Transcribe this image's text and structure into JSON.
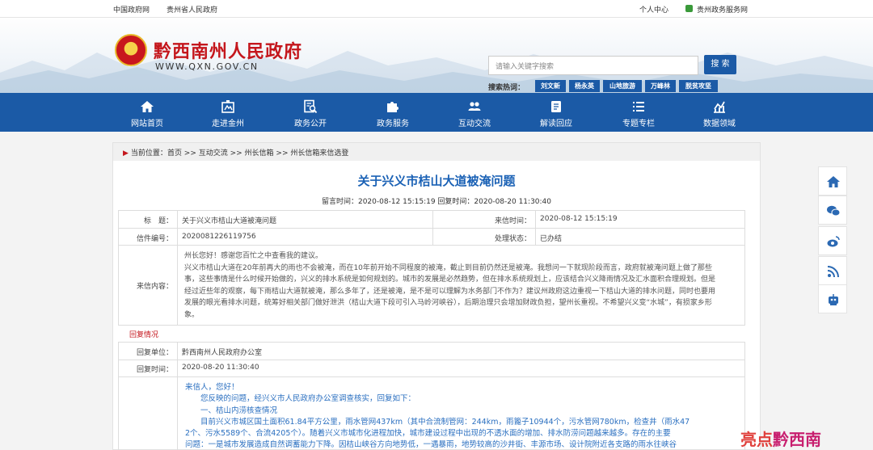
{
  "topbar": {
    "links_left": [
      "中国政府网",
      "贵州省人民政府"
    ],
    "links_right": [
      "个人中心",
      "贵州政务服务网"
    ]
  },
  "header": {
    "site_title": "黔西南州人民政府",
    "site_url": "WWW.QXN.GOV.CN",
    "search_placeholder": "请输入关键字搜索",
    "search_button": "搜 索",
    "hot_label": "搜索热词：",
    "hot_words": [
      "刘文新",
      "杨永英",
      "山地旅游",
      "万峰林",
      "脱贫攻坚"
    ]
  },
  "nav": {
    "items": [
      {
        "label": "网站首页",
        "icon": "home-icon"
      },
      {
        "label": "走进金州",
        "icon": "landmark-icon"
      },
      {
        "label": "政务公开",
        "icon": "document-search-icon"
      },
      {
        "label": "政务服务",
        "icon": "puzzle-icon"
      },
      {
        "label": "互动交流",
        "icon": "people-icon"
      },
      {
        "label": "解读回应",
        "icon": "clipboard-icon"
      },
      {
        "label": "专题专栏",
        "icon": "list-icon"
      },
      {
        "label": "数据领域",
        "icon": "chart-icon"
      }
    ]
  },
  "breadcrumb": {
    "prefix": "当前位置：",
    "path": "首页 >> 互动交流 >> 州长信箱 >> 州长信箱来信选登"
  },
  "article": {
    "title": "关于兴义市桔山大道被淹问题",
    "meta": "留言时间：2020-08-12 15:15:19  回复时间：2020-08-20 11:30:40"
  },
  "letter": {
    "subject_label": "标　题：",
    "subject": "关于兴义市桔山大道被淹问题",
    "received_time_label": "来信时间：",
    "received_time": "2020-08-12 15:15:19",
    "number_label": "信件编号：",
    "number": "2020081226119756",
    "status_label": "处理状态：",
    "status": "已办结",
    "content_label": "来信内容：",
    "content_lines": [
      "州长您好！感谢您百忙之中查看我的建议。",
      "兴义市桔山大道在20年前再大的雨也不会被淹，而在10年前开始不同程度的被淹，截止到目前仍然还是被淹。我想问一下就现阶段而言，政府就被淹问题上做了那些",
      "事，这些事情是什么时候开始做的，兴义的排水系统是如何规划的。城市的发展是必然趋势，但在排水系统规划上，应该结合兴义降雨情况及汇水面积合理规划。但是",
      "经过近些年的观察，每下雨桔山大道就被淹，那么多年了，还是被淹，是不是可以理解为水务部门不作为？建议州政府这边重视一下桔山大道的排水问题，同时也要用",
      "发展的眼光看排水问题，统筹好相关部门做好泄洪（桔山大道下段可引入马岭河峡谷），后期治理只会增加财政负担，望州长重视。不希望兴义变“水城”，有损家乡形",
      "象。"
    ]
  },
  "reply": {
    "section_title": "回复情况",
    "unit_label": "回复单位：",
    "unit": "黔西南州人民政府办公室",
    "time_label": "回复时间：",
    "time": "2020-08-20 11:30:40",
    "body_lines": [
      "来信人，您好！",
      "　　您反映的问题，经兴义市人民政府办公室调查核实，回复如下：",
      "　　一、桔山内涝核查情况",
      "　　目前兴义市城区国土面积61.84平方公里，雨水管网437km（其中合流制管网：244km，雨篦子10944个，污水管网780km，检查井（雨水47",
      "2个、污水5589个、合流4205个）。随着兴义市城市化进程加快，城市建设过程中出现的不透水面的增加、排水防涝问题越来越多。存在的主要",
      "问题：一是城市发展造成自然调蓄能力下降。因桔山峡谷方向地势低，一遇暴雨，地势较高的沙井街、丰源市场、设计院附近各支路的雨水往峡谷"
    ]
  },
  "sidebar": {
    "buttons": [
      "home-icon",
      "wechat-icon",
      "weibo-icon",
      "rss-icon",
      "robot-icon"
    ]
  },
  "watermark": {
    "text_a": "亮点",
    "text_b": "黔西南"
  },
  "colors": {
    "brand_blue": "#1b5aa6",
    "title_red": "#c4161c",
    "link_blue": "#1a61b5"
  }
}
